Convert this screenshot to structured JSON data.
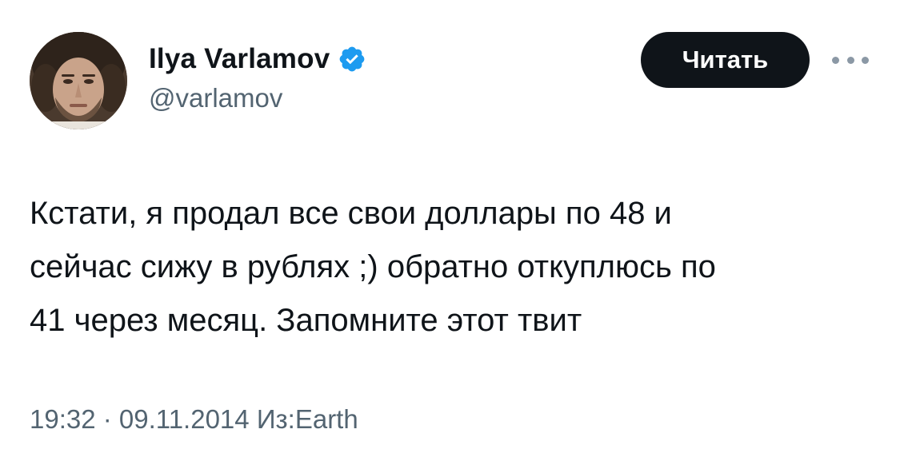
{
  "author": {
    "name": "Ilya Varlamov",
    "handle": "@varlamov",
    "verified": true
  },
  "actions": {
    "follow_label": "Читать",
    "more_icon": "more-horizontal-icon"
  },
  "tweet": {
    "text": "Кстати, я продал все свои доллары по 48 и\nсейчас сижу в рублях ;) обратно откуплюсь по\n41 через месяц. Запомните этот твит",
    "time": "19:32",
    "separator": " · ",
    "date": "09.11.2014",
    "source": "Из:Earth"
  },
  "colors": {
    "text_primary": "#0f1419",
    "text_secondary": "#536471",
    "verified_blue": "#1d9bf0",
    "button_bg": "#0f1419",
    "button_text": "#ffffff"
  }
}
